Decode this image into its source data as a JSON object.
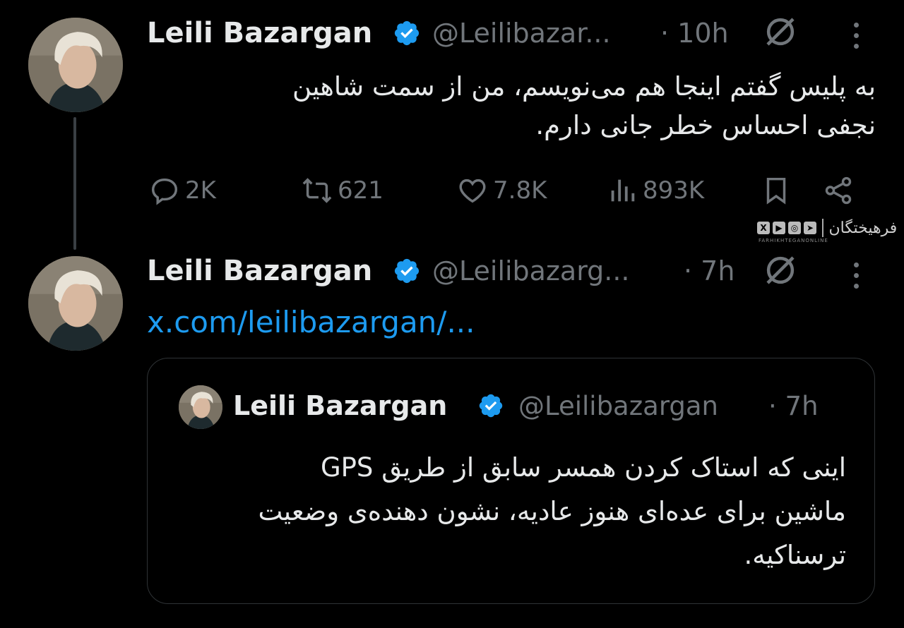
{
  "colors": {
    "background": "#000000",
    "text": "#e7e9ea",
    "muted": "#71767b",
    "link": "#1d9bf0",
    "verified": "#1d9bf0",
    "border": "#2f3336"
  },
  "tweet1": {
    "name": "Leili Bazargan",
    "handle": "@Leilibazar...",
    "time": "· 10h",
    "text_line1": "به پلیس گفتم اینجا هم می‌نویسم، من از سمت شاهین",
    "text_line2": "نجفی احساس خطر جانی دارم.",
    "actions": {
      "replies": "2K",
      "reposts": "621",
      "likes": "7.8K",
      "views": "893K"
    }
  },
  "tweet2": {
    "name": "Leili Bazargan",
    "handle": "@Leilibazarg...",
    "time": "· 7h",
    "link": "x.com/leilibazargan/..."
  },
  "quote": {
    "name": "Leili Bazargan",
    "handle": "@Leilibazargan",
    "time": "· 7h",
    "text_line1": "اینی که استاک کردن همسر سابق از طریق GPS",
    "text_line2": "ماشین برای عده‌ای هنوز عادیه، نشون دهنده‌ی وضعیت",
    "text_line3": "ترسناکیه."
  },
  "icons": [
    "verified-badge-icon",
    "grok-icon",
    "more-icon",
    "reply-icon",
    "repost-icon",
    "like-icon",
    "views-icon",
    "bookmark-icon",
    "share-icon"
  ],
  "watermark": {
    "logo": "فرهیختگان",
    "sub": "FARHIKHTEGANONLINE"
  }
}
